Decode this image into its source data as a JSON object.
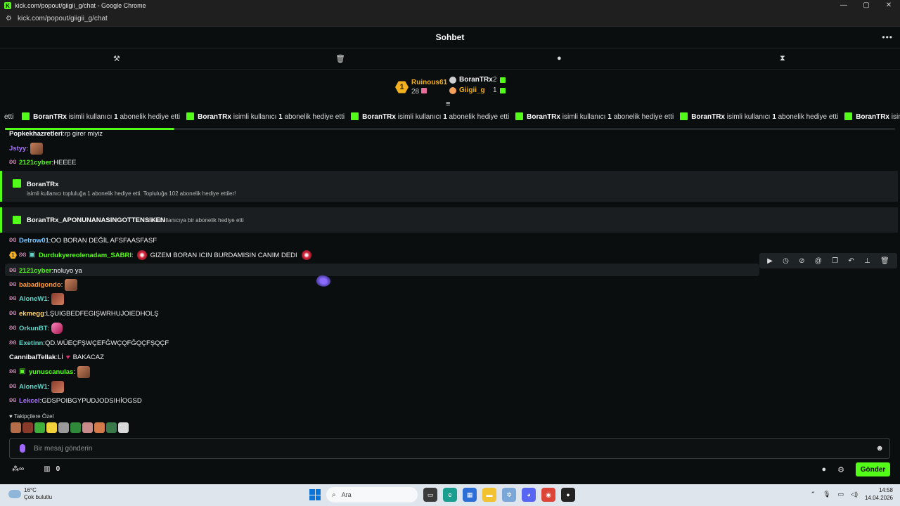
{
  "window": {
    "title": "kick.com/popout/giigii_g/chat - Google Chrome",
    "url": "kick.com/popout/giigii_g/chat",
    "controls": [
      "—",
      "▢",
      "✕"
    ]
  },
  "chat": {
    "title": "Sohbet",
    "more_icon": "more-icon",
    "mod_tools": [
      "hammer-icon",
      "trash-icon",
      "message-icon",
      "hourglass-icon"
    ]
  },
  "leaderboard": {
    "first": {
      "rank": "1",
      "name": "Ruinous61",
      "count": "28"
    },
    "others": [
      {
        "name": "BoranTRx",
        "count": "2",
        "color": "#f1f1f1"
      },
      {
        "name": "Giigii_g",
        "count": "1",
        "color": "#f2b01e"
      }
    ]
  },
  "ticker": {
    "items": [
      {
        "user": "BoranTRx",
        "text": "isimli kullanıcı",
        "count": "1",
        "rest": "abonelik hediye etti"
      },
      {
        "user": "BoranTRx",
        "text": "isimli kullanıcı",
        "count": "1",
        "rest": "abonelik hediye etti"
      },
      {
        "user": "BoranTRx",
        "text": "isimli kullanıcı",
        "count": "1",
        "rest": "abonelik hediye etti"
      },
      {
        "user": "BoranTRx",
        "text": "isimli kullanıcı",
        "count": "1",
        "rest": "abonelik hediye etti"
      },
      {
        "user": "BoranTRx",
        "text": "isimli kullanıcı",
        "count": "1",
        "rest": "abonelik hediye etti"
      },
      {
        "user": "BoranTRx",
        "text": "isimli kullanıcı",
        "count": "1",
        "rest": "abonelik hediye etti"
      }
    ],
    "lead_text": "etti",
    "progress": 0.19
  },
  "messages": [
    {
      "user": "Popkekhazretleri",
      "color": "#ffffff",
      "text": "rp girer miyiz",
      "badge": false
    },
    {
      "user": "Jstyy",
      "color": "#a974ff",
      "text": "",
      "emote": true,
      "badge": false
    },
    {
      "user": "2121cyber",
      "color": "#53fc18",
      "text": "HEEEE",
      "badge": true
    },
    {
      "user": "Detrow01",
      "color": "#7cc8ff",
      "text": "OO BORAN DEĞİL AFSFAASFASF",
      "badge": true
    },
    {
      "user": "Durdukyereolenadam_SABRI",
      "color": "#53fc18",
      "text": "GIZEM BORAN ICIN BURDAMISIN CANIM DEDI",
      "badge": true
    },
    {
      "user": "2121cyber",
      "color": "#53fc18",
      "text": "noluyo ya",
      "badge": true
    },
    {
      "user": "babadigondo",
      "color": "#ff9a3c",
      "text": "",
      "badge": true
    },
    {
      "user": "AloneW1",
      "color": "#5fd3c7",
      "text": "",
      "badge": true
    },
    {
      "user": "ekmegg",
      "color": "#ffd36b",
      "text": "LŞUIGBEDFEGIŞWRHUJOIEDHOLŞ",
      "badge": true
    },
    {
      "user": "OrkunBT",
      "color": "#5fd3c7",
      "text": "",
      "badge": true
    },
    {
      "user": "Exetinn",
      "color": "#5fd3c7",
      "text": "QD.WÜEÇFŞWÇEFĞWÇQFĞQÇFŞQÇF",
      "badge": true
    },
    {
      "user": "CannibalTellak",
      "color": "#ffffff",
      "text": "Lİ",
      "text2": "BAKACAZ",
      "badge": false
    },
    {
      "user": "yunuscanulas",
      "color": "#53fc18",
      "text": "",
      "badge": true
    },
    {
      "user": "AloneW1",
      "color": "#5fd3c7",
      "text": "",
      "badge": true
    },
    {
      "user": "Lekcel",
      "color": "#a974ff",
      "text": "GDSPOIBGYPUDJODSIHİOGSD",
      "badge": true
    }
  ],
  "notices": [
    {
      "title": "BoranTRx",
      "text": "isimli kullanıcı topluluğa 1 abonelik hediye etti. Topluluğa 102 abonelik hediye ettiler!"
    },
    {
      "title": "BoranTRx_APONUNANASINGOTTENSIKEN",
      "text": "isimli kullanıcıya bir abonelik hediye etti"
    }
  ],
  "hover_tools": [
    "play-icon",
    "clock-icon",
    "slash-icon",
    "at-icon",
    "copy-icon",
    "undo-icon",
    "pin-icon",
    "trash-icon"
  ],
  "followers": {
    "label": "Takipçilere Özel"
  },
  "input": {
    "placeholder": "Bir mesaj gönderin"
  },
  "bottom": {
    "points": "0",
    "send_label": "Gönder"
  },
  "taskbar": {
    "weather_temp": "16°C",
    "weather_desc": "Çok bulutlu",
    "search_label": "Ara",
    "time": "14:58",
    "date": "14.04.2026"
  },
  "colors": {
    "accent": "#53fc18",
    "background": "#0b0e0f",
    "gold": "#f2b01e"
  }
}
